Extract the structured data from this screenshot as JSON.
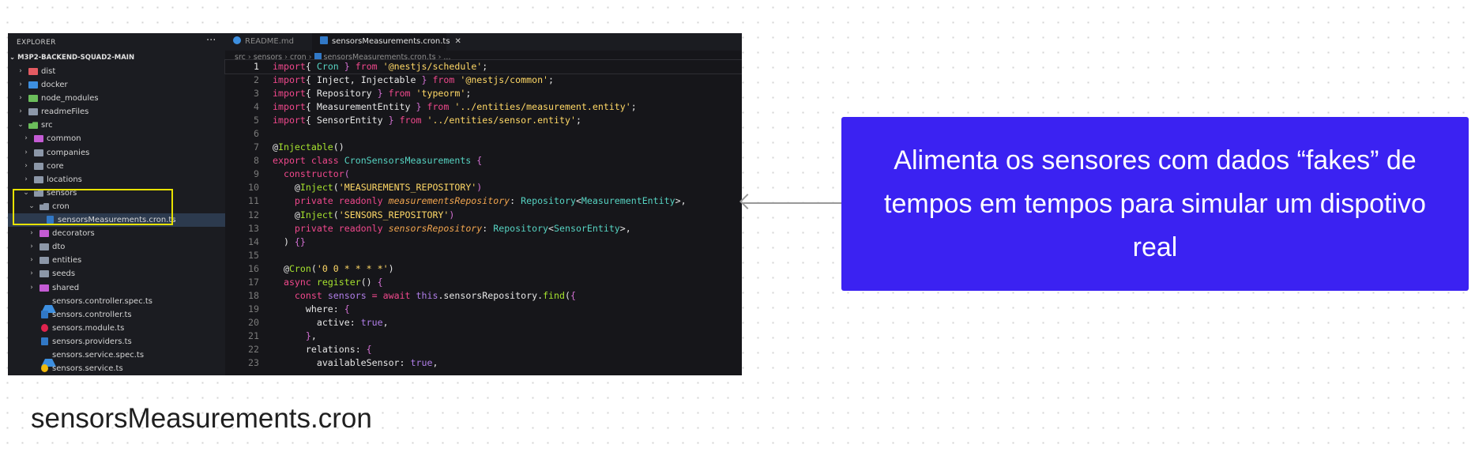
{
  "explorer": {
    "title": "EXPLORER",
    "menu_dots": "···",
    "root_label": "M3P2-BACKEND-SQUAD2-MAIN",
    "tree": [
      {
        "label": "dist",
        "type": "folder",
        "depth": 0,
        "open": false,
        "color": "f-red"
      },
      {
        "label": "docker",
        "type": "folder",
        "depth": 0,
        "open": false,
        "color": "f-blue"
      },
      {
        "label": "node_modules",
        "type": "folder",
        "depth": 0,
        "open": false,
        "color": "f-green"
      },
      {
        "label": "readmeFiles",
        "type": "folder",
        "depth": 0,
        "open": false,
        "color": ""
      },
      {
        "label": "src",
        "type": "folder",
        "depth": 0,
        "open": true,
        "color": "f-green"
      },
      {
        "label": "common",
        "type": "folder",
        "depth": 1,
        "open": false,
        "color": "f-pink"
      },
      {
        "label": "companies",
        "type": "folder",
        "depth": 1,
        "open": false,
        "color": ""
      },
      {
        "label": "core",
        "type": "folder",
        "depth": 1,
        "open": false,
        "color": ""
      },
      {
        "label": "locations",
        "type": "folder",
        "depth": 1,
        "open": false,
        "color": ""
      },
      {
        "label": "sensors",
        "type": "folder",
        "depth": 1,
        "open": true,
        "color": ""
      },
      {
        "label": "cron",
        "type": "folder",
        "depth": 2,
        "open": true,
        "color": ""
      },
      {
        "label": "sensorsMeasurements.cron.ts",
        "type": "file",
        "depth": 3,
        "kind": "ts",
        "selected": true
      },
      {
        "label": "decorators",
        "type": "folder",
        "depth": 2,
        "open": false,
        "color": "f-pink"
      },
      {
        "label": "dto",
        "type": "folder",
        "depth": 2,
        "open": false,
        "color": ""
      },
      {
        "label": "entities",
        "type": "folder",
        "depth": 2,
        "open": false,
        "color": ""
      },
      {
        "label": "seeds",
        "type": "folder",
        "depth": 2,
        "open": false,
        "color": ""
      },
      {
        "label": "shared",
        "type": "folder",
        "depth": 2,
        "open": false,
        "color": "f-pink"
      },
      {
        "label": "sensors.controller.spec.ts",
        "type": "file",
        "depth": 2,
        "kind": "spec"
      },
      {
        "label": "sensors.controller.ts",
        "type": "file",
        "depth": 2,
        "kind": "ts"
      },
      {
        "label": "sensors.module.ts",
        "type": "file",
        "depth": 2,
        "kind": "module"
      },
      {
        "label": "sensors.providers.ts",
        "type": "file",
        "depth": 2,
        "kind": "ts"
      },
      {
        "label": "sensors.service.spec.ts",
        "type": "file",
        "depth": 2,
        "kind": "spec"
      },
      {
        "label": "sensors.service.ts",
        "type": "file",
        "depth": 2,
        "kind": "service"
      }
    ]
  },
  "tabs": {
    "readme": "README.md",
    "active": "sensorsMeasurements.cron.ts",
    "close": "✕"
  },
  "breadcrumb": [
    "src",
    "sensors",
    "cron",
    "sensorsMeasurements.cron.ts",
    "..."
  ],
  "code_lines": [
    [
      [
        "k",
        "import"
      ],
      [
        "",
        "{ "
      ],
      [
        "t",
        "Cron"
      ],
      [
        "br",
        " } "
      ],
      [
        "k",
        "from"
      ],
      [
        "s",
        " '@nestjs/schedule'"
      ],
      [
        "",
        ";"
      ]
    ],
    [
      [
        "k",
        "import"
      ],
      [
        "",
        "{ Inject, Injectable "
      ],
      [
        "br",
        "} "
      ],
      [
        "k",
        "from"
      ],
      [
        "s",
        " '@nestjs/common'"
      ],
      [
        "",
        ";"
      ]
    ],
    [
      [
        "k",
        "import"
      ],
      [
        "",
        "{ Repository "
      ],
      [
        "br",
        "} "
      ],
      [
        "k",
        "from"
      ],
      [
        "s",
        " 'typeorm'"
      ],
      [
        "",
        ";"
      ]
    ],
    [
      [
        "k",
        "import"
      ],
      [
        "",
        "{ MeasurementEntity "
      ],
      [
        "br",
        "} "
      ],
      [
        "k",
        "from"
      ],
      [
        "s",
        " '../entities/measurement.entity'"
      ],
      [
        "",
        ";"
      ]
    ],
    [
      [
        "k",
        "import"
      ],
      [
        "",
        "{ SensorEntity "
      ],
      [
        "br",
        "} "
      ],
      [
        "k",
        "from"
      ],
      [
        "s",
        " '../entities/sensor.entity'"
      ],
      [
        "",
        ";"
      ]
    ],
    [],
    [
      [
        "",
        "@"
      ],
      [
        "fn",
        "Injectable"
      ],
      [
        "",
        "()"
      ]
    ],
    [
      [
        "k",
        "export class "
      ],
      [
        "t",
        "CronSensorsMeasurements "
      ],
      [
        "br",
        "{"
      ]
    ],
    [
      [
        "",
        "  "
      ],
      [
        "k",
        "constructor"
      ],
      [
        "br",
        "("
      ]
    ],
    [
      [
        "",
        "    @"
      ],
      [
        "fn",
        "Inject"
      ],
      [
        "",
        "("
      ],
      [
        "s",
        "'MEASUREMENTS_REPOSITORY'"
      ],
      [
        "br",
        ")"
      ]
    ],
    [
      [
        "",
        "    "
      ],
      [
        "k",
        "private readonly "
      ],
      [
        "it",
        "measurementsRepository"
      ],
      [
        "",
        ": "
      ],
      [
        "t",
        "Repository"
      ],
      [
        "",
        "<"
      ],
      [
        "t",
        "MeasurementEntity"
      ],
      [
        "",
        ">,"
      ]
    ],
    [
      [
        "",
        "    @"
      ],
      [
        "fn",
        "Inject"
      ],
      [
        "",
        "("
      ],
      [
        "s",
        "'SENSORS_REPOSITORY'"
      ],
      [
        "br",
        ")"
      ]
    ],
    [
      [
        "",
        "    "
      ],
      [
        "k",
        "private readonly "
      ],
      [
        "it",
        "sensorsRepository"
      ],
      [
        "",
        ": "
      ],
      [
        "t",
        "Repository"
      ],
      [
        "",
        "<"
      ],
      [
        "t",
        "SensorEntity"
      ],
      [
        "",
        ">,"
      ]
    ],
    [
      [
        "",
        "  ) "
      ],
      [
        "br",
        "{}"
      ]
    ],
    [],
    [
      [
        "",
        "  @"
      ],
      [
        "fn",
        "Cron"
      ],
      [
        "",
        "("
      ],
      [
        "s",
        "'0 0 * * * *'"
      ],
      [
        "",
        ")"
      ]
    ],
    [
      [
        "",
        "  "
      ],
      [
        "k",
        "async "
      ],
      [
        "fn",
        "register"
      ],
      [
        "",
        "() "
      ],
      [
        "br",
        "{"
      ]
    ],
    [
      [
        "",
        "    "
      ],
      [
        "k",
        "const "
      ],
      [
        "p",
        "sensors"
      ],
      [
        "",
        ""
      ],
      [
        "k",
        " = await "
      ],
      [
        "p",
        "this"
      ],
      [
        "",
        ".sensorsRepository."
      ],
      [
        "fn",
        "find"
      ],
      [
        "",
        "("
      ],
      [
        "br",
        "{"
      ]
    ],
    [
      [
        "",
        "      where: "
      ],
      [
        "br",
        "{"
      ]
    ],
    [
      [
        "",
        "        active: "
      ],
      [
        "p",
        "true"
      ],
      [
        "",
        ","
      ]
    ],
    [
      [
        "",
        "      "
      ],
      [
        "br",
        "}"
      ],
      [
        "",
        ","
      ]
    ],
    [
      [
        "",
        "      relations: "
      ],
      [
        "br",
        "{"
      ]
    ],
    [
      [
        "",
        "        availableSensor: "
      ],
      [
        "p",
        "true"
      ],
      [
        "",
        ","
      ]
    ]
  ],
  "callout": {
    "text": "Alimenta os sensores com dados “fakes” de tempos em tempos para simular um dispotivo real",
    "color": "#3b22f2"
  },
  "caption": "sensorsMeasurements.cron",
  "colors": {
    "highlight": "#e8e200",
    "editor_bg": "#16161a"
  }
}
